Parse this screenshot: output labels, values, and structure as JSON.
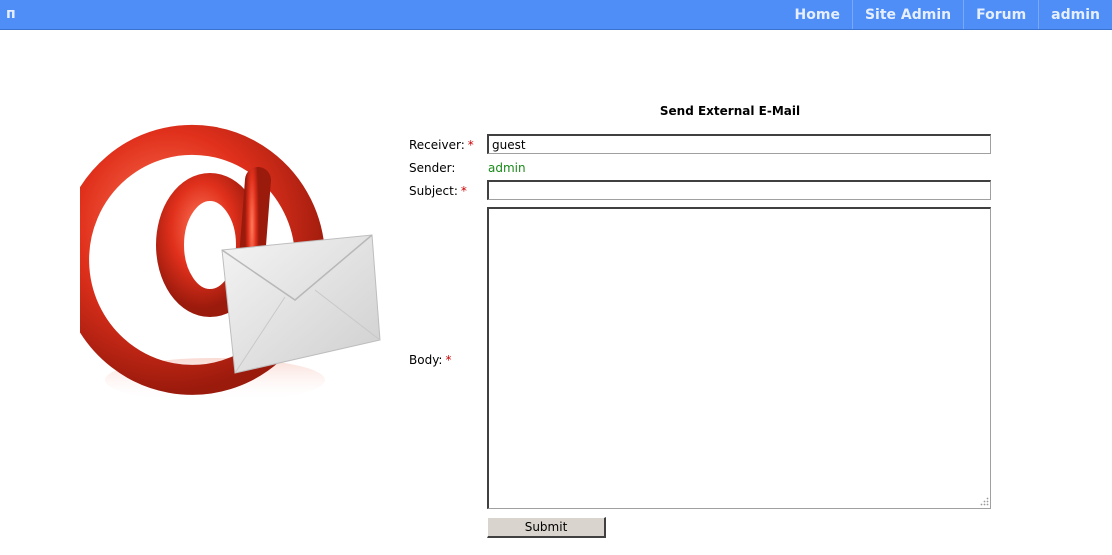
{
  "topbar": {
    "brand": "п",
    "nav": [
      "Home",
      "Site Admin",
      "Forum",
      "admin"
    ],
    "bg_color": "#4f8ef7"
  },
  "illustration": {
    "icon": "email-at-envelope-icon"
  },
  "form": {
    "title": "Send External E-Mail",
    "receiver_label": "Receiver:",
    "receiver_value": "guest",
    "sender_label": "Sender:",
    "sender_value": "admin",
    "subject_label": "Subject:",
    "subject_value": "",
    "body_label": "Body:",
    "body_value": "",
    "required_marker": "*",
    "submit_label": "Submit"
  }
}
